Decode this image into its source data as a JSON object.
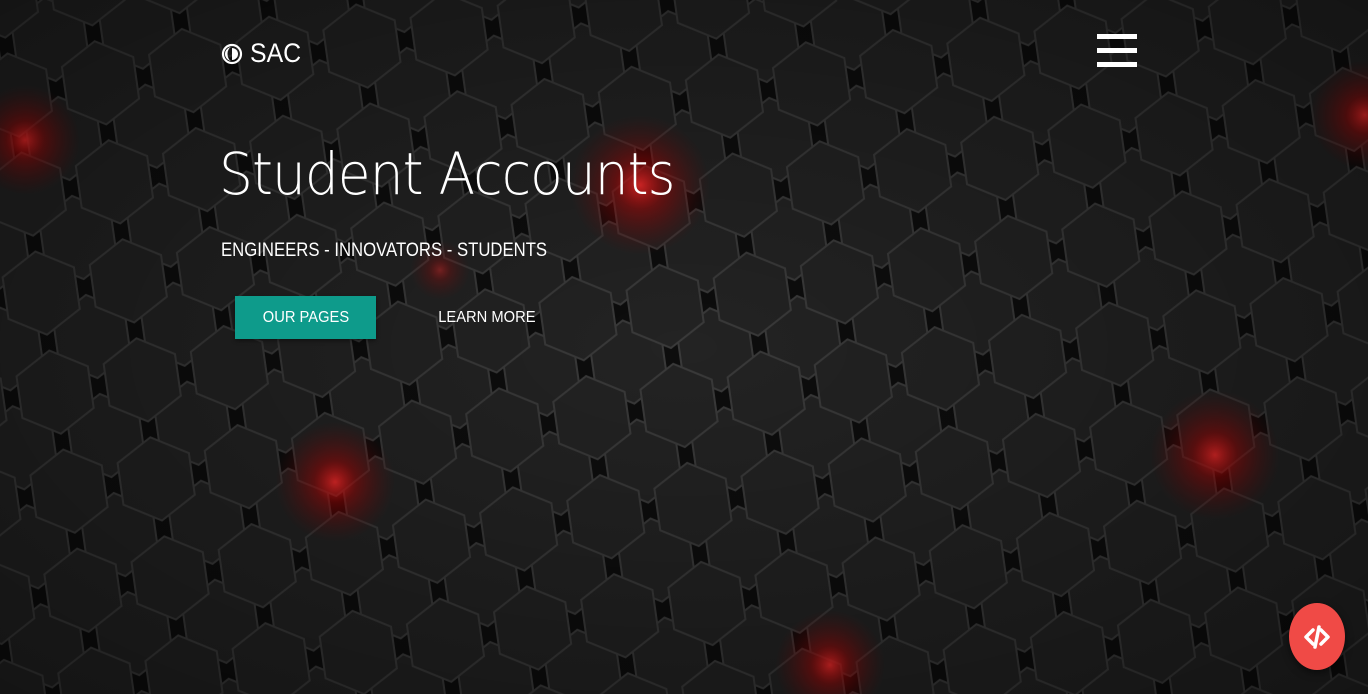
{
  "brand": {
    "name": "SAC",
    "icon": "half-moon-icon"
  },
  "header": {
    "menu_icon": "hamburger-menu-icon"
  },
  "hero": {
    "title": "Student Accounts",
    "subtitle": "ENGINEERS - INNOVATORS - STUDENTS",
    "primary_button": "OUR PAGES",
    "secondary_button": "LEARN MORE"
  },
  "fab": {
    "icon": "code-slash-icon"
  },
  "colors": {
    "accent": "#0e9b8b",
    "fab": "#f04a46",
    "glow": "#ff1a1a",
    "background": "#151515"
  }
}
